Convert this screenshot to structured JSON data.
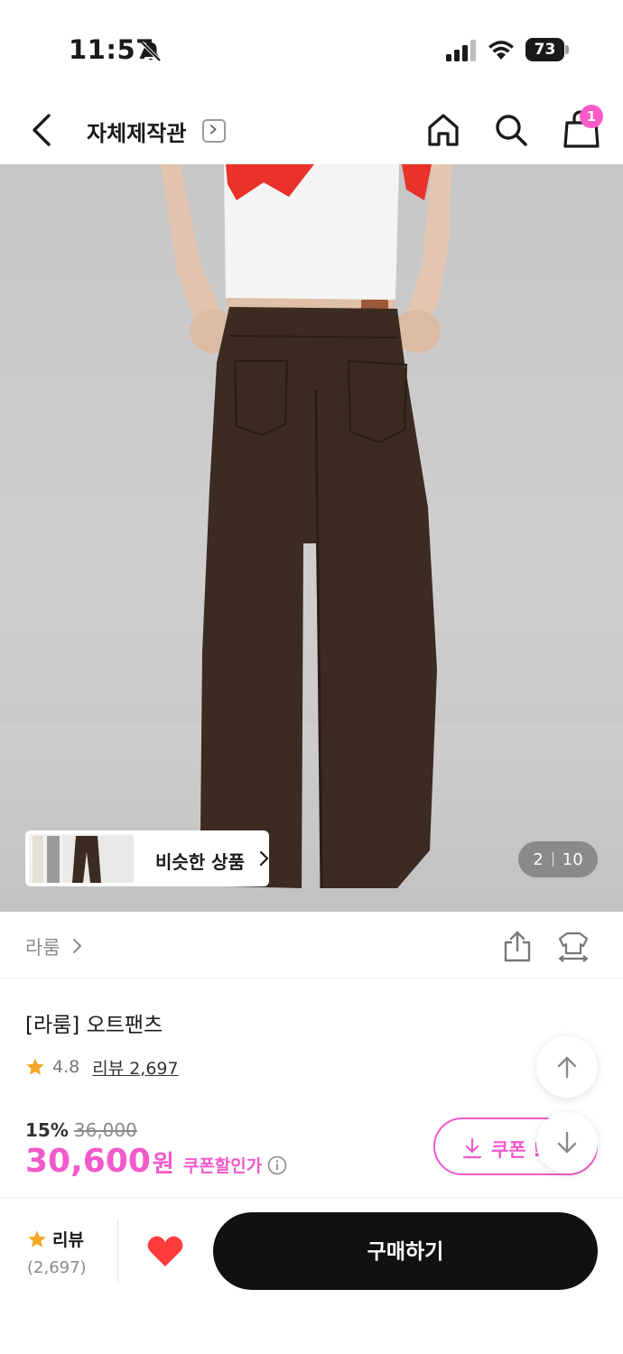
{
  "status_bar": {
    "time": "11:57",
    "battery": "73",
    "icons": [
      "bell-off-icon",
      "signal-icon",
      "wifi-icon",
      "battery-icon"
    ]
  },
  "nav": {
    "title": "자체제작관",
    "icons": [
      "back-chevron-icon",
      "home-icon",
      "search-icon",
      "cart-icon"
    ],
    "cart_badge": "1"
  },
  "gallery": {
    "similar_label": "비슷한 상품",
    "page_current": "2",
    "page_total": "10"
  },
  "brand": {
    "name": "라룸",
    "icons": [
      "share-icon",
      "fit-compare-icon"
    ]
  },
  "product": {
    "title": "[라룸] 오트팬츠",
    "rating": "4.8",
    "review_label": "리뷰 2,697",
    "discount_rate": "15%",
    "original_price": "36,000",
    "sale_price": "30,600",
    "sale_unit": "원",
    "coupon_price_label": "쿠폰할인가",
    "coupon_button_label": "쿠폰 !"
  },
  "bottom_bar": {
    "review_label": "리뷰",
    "review_count": "(2,697)",
    "buy_label": "구매하기"
  },
  "colors": {
    "accent": "#f25acb",
    "badge": "#ff5ac8",
    "buy_button": "#111111",
    "heart": "#ff3b3b",
    "star": "#f5a623"
  }
}
